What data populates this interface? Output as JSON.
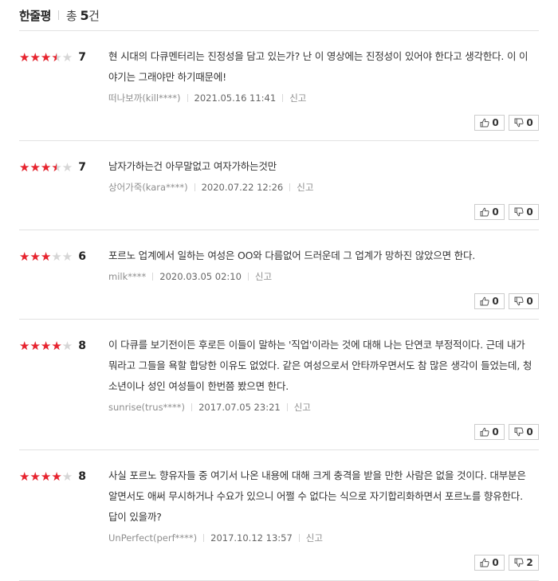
{
  "header": {
    "title": "한줄평",
    "total_prefix": "총",
    "total_count": "5",
    "total_suffix": "건"
  },
  "reviews": [
    {
      "rating": 7,
      "text": "현 시대의 다큐멘터리는 진정성을 담고 있는가? 난 이 영상에는 진정성이 있어야 한다고 생각한다. 이 이야기는 그래야만 하기때문에!",
      "user": "떠나보까(kill****)",
      "date": "2021.05.16 11:41",
      "report": "신고",
      "likes": "0",
      "dislikes": "0"
    },
    {
      "rating": 7,
      "text": "남자가하는건 아무말없고 여자가하는것만",
      "user": "상어가죽(kara****)",
      "date": "2020.07.22 12:26",
      "report": "신고",
      "likes": "0",
      "dislikes": "0"
    },
    {
      "rating": 6,
      "text": "포르노 업계에서 일하는 여성은 OO와 다름없어 드러운데 그 업계가 망하진 않았으면 한다.",
      "user": "milk****",
      "date": "2020.03.05 02:10",
      "report": "신고",
      "likes": "0",
      "dislikes": "0"
    },
    {
      "rating": 8,
      "text": "이 다큐를 보기전이든 후로든 이들이 말하는 '직업'이라는 것에 대해 나는 단연코 부정적이다. 근데 내가 뭐라고 그들을 욕할 합당한 이유도 없었다. 같은 여성으로서 안타까우면서도 참 많은 생각이 들었는데, 청소년이나 성인 여성들이 한번쯤 봤으면 한다.",
      "user": "sunrise(trus****)",
      "date": "2017.07.05 23:21",
      "report": "신고",
      "likes": "0",
      "dislikes": "0"
    },
    {
      "rating": 8,
      "text": "사실 포르노 향유자들 중 여기서 나온 내용에 대해 크게 충격을 받을 만한 사람은 없을 것이다. 대부분은 알면서도 애써 무시하거나 수요가 있으니 어쩔 수 없다는 식으로 자기합리화하면서 포르노를 향유한다. 답이 있을까?",
      "user": "UnPerfect(perf****)",
      "date": "2017.10.12 13:57",
      "report": "신고",
      "likes": "0",
      "dislikes": "2"
    }
  ],
  "colors": {
    "star_filled": "#e8232e",
    "star_empty": "#d6d6d6"
  },
  "icons": {
    "like": "thumbs-up-icon",
    "dislike": "thumbs-down-icon",
    "star": "star-icon"
  }
}
